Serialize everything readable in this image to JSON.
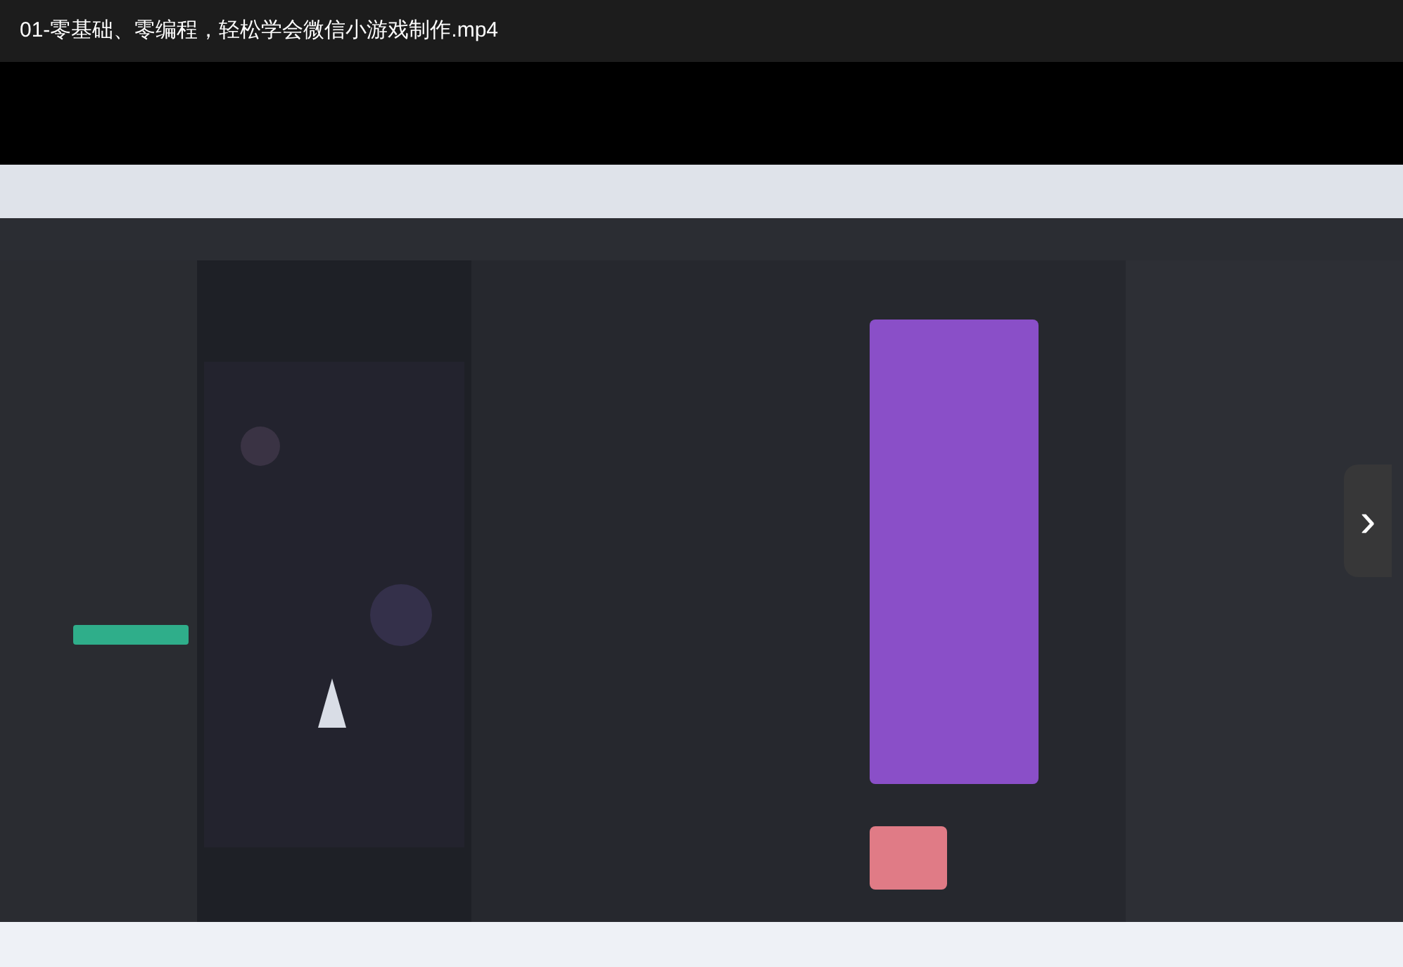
{
  "player": {
    "title": "01-零基础、零编程，轻松学会微信小游戏制作.mp4"
  },
  "next_button": {
    "label": "›"
  }
}
